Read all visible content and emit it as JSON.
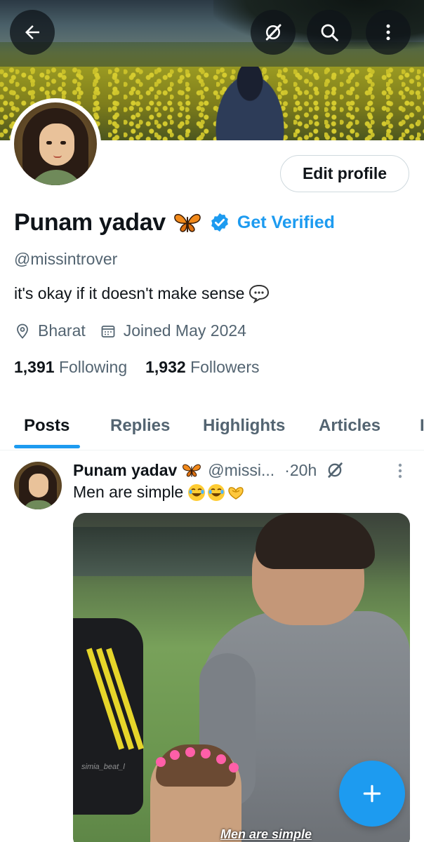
{
  "header": {
    "back_icon": "arrow-left-icon",
    "grok_icon": "grok-icon",
    "search_icon": "search-icon",
    "more_icon": "more-vertical-icon"
  },
  "profile": {
    "name": "Punam yadav",
    "name_emoji": "butterfly-emoji",
    "get_verified": "Get Verified",
    "handle": "@missintrover",
    "bio": "it's okay if it doesn't make sense",
    "bio_emoji": "speech-balloon-emoji",
    "location": "Bharat",
    "joined": "Joined May 2024",
    "following_count": "1,391",
    "following_label": "Following",
    "followers_count": "1,932",
    "followers_label": "Followers",
    "edit_profile": "Edit profile"
  },
  "tabs": [
    {
      "label": "Posts",
      "active": true
    },
    {
      "label": "Replies",
      "active": false
    },
    {
      "label": "Highlights",
      "active": false
    },
    {
      "label": "Articles",
      "active": false
    },
    {
      "label": "I",
      "active": false
    }
  ],
  "post": {
    "author": "Punam yadav",
    "handle": "@missi...",
    "time": "·20h",
    "text": "Men are simple",
    "text_emojis": [
      "joy-emoji",
      "joy-emoji",
      "heart-hands-emoji"
    ],
    "media_caption": "Men are simple",
    "media_watermark": "simia_beat_l"
  },
  "fab": {
    "icon": "plus-icon"
  },
  "colors": {
    "accent": "#1d9bf0",
    "text_primary": "#0f1419",
    "text_secondary": "#536471"
  }
}
